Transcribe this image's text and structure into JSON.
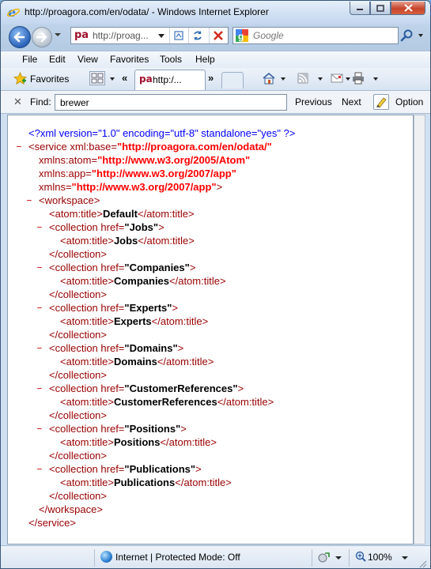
{
  "window": {
    "title": "http://proagora.com/en/odata/ - Windows Internet Explorer"
  },
  "nav": {
    "address_favicon": "pa",
    "address_text": "http://proag...",
    "search_placeholder": "Google"
  },
  "menu": [
    "File",
    "Edit",
    "View",
    "Favorites",
    "Tools",
    "Help"
  ],
  "favbar": {
    "favorites_label": "Favorites",
    "tab_favicon": "pa",
    "tab_label": "http:/...",
    "chevron_left": "«",
    "chevron_right": "»"
  },
  "find": {
    "close_glyph": "✕",
    "label": "Find:",
    "value": "brewer",
    "previous": "Previous",
    "next": "Next",
    "options": "Option"
  },
  "xml": {
    "minus": "–",
    "decl": "<?xml version=\"1.0\" encoding=\"utf-8\" standalone=\"yes\" ?>",
    "service_open": "<service",
    "xml_base_attr": " xml:base=",
    "xml_base_val": "\"http://proagora.com/en/odata/\"",
    "atom_attr": "xmlns:atom=",
    "atom_val": "\"http://www.w3.org/2005/Atom\"",
    "app_attr": "xmlns:app=",
    "app_val": "\"http://www.w3.org/2007/app\"",
    "xmlns_attr": "xmlns=",
    "xmlns_val": "\"http://www.w3.org/2007/app\"",
    "close_bracket": ">",
    "workspace_open": "<workspace>",
    "title_open": "<atom:title>",
    "title_close": "</atom:title>",
    "workspace_title": "Default",
    "collection_open": "<collection",
    "href_attr": " href=",
    "collection_close": "</collection>",
    "workspace_close": "</workspace>",
    "service_close": "</service>",
    "collections": [
      {
        "href": "\"Jobs\"",
        "title": "Jobs"
      },
      {
        "href": "\"Companies\"",
        "title": "Companies"
      },
      {
        "href": "\"Experts\"",
        "title": "Experts"
      },
      {
        "href": "\"Domains\"",
        "title": "Domains"
      },
      {
        "href": "\"CustomerReferences\"",
        "title": "CustomerReferences"
      },
      {
        "href": "\"Positions\"",
        "title": "Positions"
      },
      {
        "href": "\"Publications\"",
        "title": "Publications"
      }
    ]
  },
  "status": {
    "zone": "Internet | Protected Mode: Off",
    "zoom": "100%"
  }
}
